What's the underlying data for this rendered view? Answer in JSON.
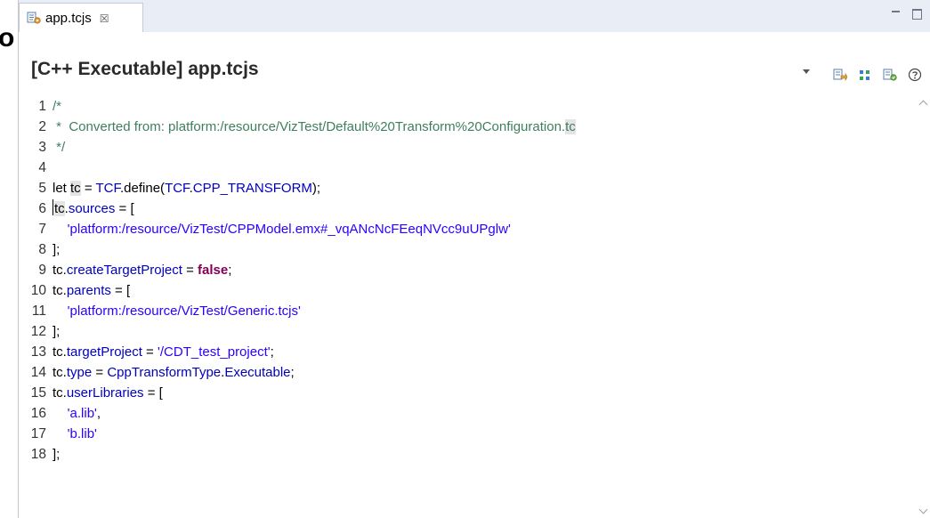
{
  "cut_glyph": "o",
  "tab": {
    "label": "app.tcjs",
    "close_glyph": "☒"
  },
  "header": {
    "title": "[C++ Executable] app.tcjs"
  },
  "toolbar": {
    "icons": [
      "export-icon",
      "grid-icon",
      "transform-icon",
      "help-icon"
    ]
  },
  "editor": {
    "lines": [
      {
        "n": "1",
        "tokens": [
          {
            "t": "/*",
            "c": "comment"
          }
        ]
      },
      {
        "n": "2",
        "tokens": [
          {
            "t": " *  Converted from: platform:/resource/VizTest/Default%20Transform%20Configuration.",
            "c": "comment"
          },
          {
            "t": "tc",
            "c": "comment hl"
          }
        ]
      },
      {
        "n": "3",
        "tokens": [
          {
            "t": " */",
            "c": "comment"
          }
        ]
      },
      {
        "n": "4",
        "tokens": []
      },
      {
        "n": "5",
        "tokens": [
          {
            "t": "let ",
            "c": "plain"
          },
          {
            "t": "tc",
            "c": "plain hl"
          },
          {
            "t": " = ",
            "c": "plain"
          },
          {
            "t": "TCF",
            "c": "ident"
          },
          {
            "t": ".define(",
            "c": "plain"
          },
          {
            "t": "TCF",
            "c": "ident"
          },
          {
            "t": ".",
            "c": "plain"
          },
          {
            "t": "CPP_TRANSFORM",
            "c": "ident"
          },
          {
            "t": ");",
            "c": "plain"
          }
        ]
      },
      {
        "n": "6",
        "tokens": [
          {
            "t": "",
            "c": "cursor"
          },
          {
            "t": "tc",
            "c": "plain hl"
          },
          {
            "t": ".",
            "c": "plain"
          },
          {
            "t": "sources",
            "c": "ident"
          },
          {
            "t": " = [",
            "c": "plain"
          }
        ]
      },
      {
        "n": "7",
        "tokens": [
          {
            "t": "    'platform:/resource/VizTest/CPPModel.emx#_vqANcNcFEeqNVcc9uUPglw'",
            "c": "string"
          }
        ]
      },
      {
        "n": "8",
        "tokens": [
          {
            "t": "];",
            "c": "plain"
          }
        ]
      },
      {
        "n": "9",
        "tokens": [
          {
            "t": "tc",
            "c": "plain"
          },
          {
            "t": ".",
            "c": "plain"
          },
          {
            "t": "createTargetProject",
            "c": "ident"
          },
          {
            "t": " = ",
            "c": "plain"
          },
          {
            "t": "false",
            "c": "keyword"
          },
          {
            "t": ";",
            "c": "plain"
          }
        ]
      },
      {
        "n": "10",
        "tokens": [
          {
            "t": "tc",
            "c": "plain"
          },
          {
            "t": ".",
            "c": "plain"
          },
          {
            "t": "parents",
            "c": "ident"
          },
          {
            "t": " = [",
            "c": "plain"
          }
        ]
      },
      {
        "n": "11",
        "tokens": [
          {
            "t": "    'platform:/resource/VizTest/Generic.tcjs'",
            "c": "string"
          }
        ]
      },
      {
        "n": "12",
        "tokens": [
          {
            "t": "];",
            "c": "plain"
          }
        ]
      },
      {
        "n": "13",
        "tokens": [
          {
            "t": "tc",
            "c": "plain"
          },
          {
            "t": ".",
            "c": "plain"
          },
          {
            "t": "targetProject",
            "c": "ident"
          },
          {
            "t": " = ",
            "c": "plain"
          },
          {
            "t": "'/CDT_test_project'",
            "c": "string"
          },
          {
            "t": ";",
            "c": "plain"
          }
        ]
      },
      {
        "n": "14",
        "tokens": [
          {
            "t": "tc",
            "c": "plain"
          },
          {
            "t": ".",
            "c": "plain"
          },
          {
            "t": "type",
            "c": "ident"
          },
          {
            "t": " = ",
            "c": "plain"
          },
          {
            "t": "CppTransformType",
            "c": "ident"
          },
          {
            "t": ".",
            "c": "plain"
          },
          {
            "t": "Executable",
            "c": "ident"
          },
          {
            "t": ";",
            "c": "plain"
          }
        ]
      },
      {
        "n": "15",
        "tokens": [
          {
            "t": "tc",
            "c": "plain"
          },
          {
            "t": ".",
            "c": "plain"
          },
          {
            "t": "userLibraries",
            "c": "ident"
          },
          {
            "t": " = [",
            "c": "plain"
          }
        ]
      },
      {
        "n": "16",
        "tokens": [
          {
            "t": "    'a.lib'",
            "c": "string"
          },
          {
            "t": ",",
            "c": "plain"
          }
        ]
      },
      {
        "n": "17",
        "tokens": [
          {
            "t": "    'b.lib'",
            "c": "string"
          }
        ]
      },
      {
        "n": "18",
        "tokens": [
          {
            "t": "];",
            "c": "plain"
          }
        ]
      }
    ]
  },
  "colors": {
    "comment": "#3f7f5f",
    "identifier": "#0000c0",
    "string": "#2a00ff",
    "keyword": "#7f0055",
    "tabbar": "#e9eef6"
  }
}
